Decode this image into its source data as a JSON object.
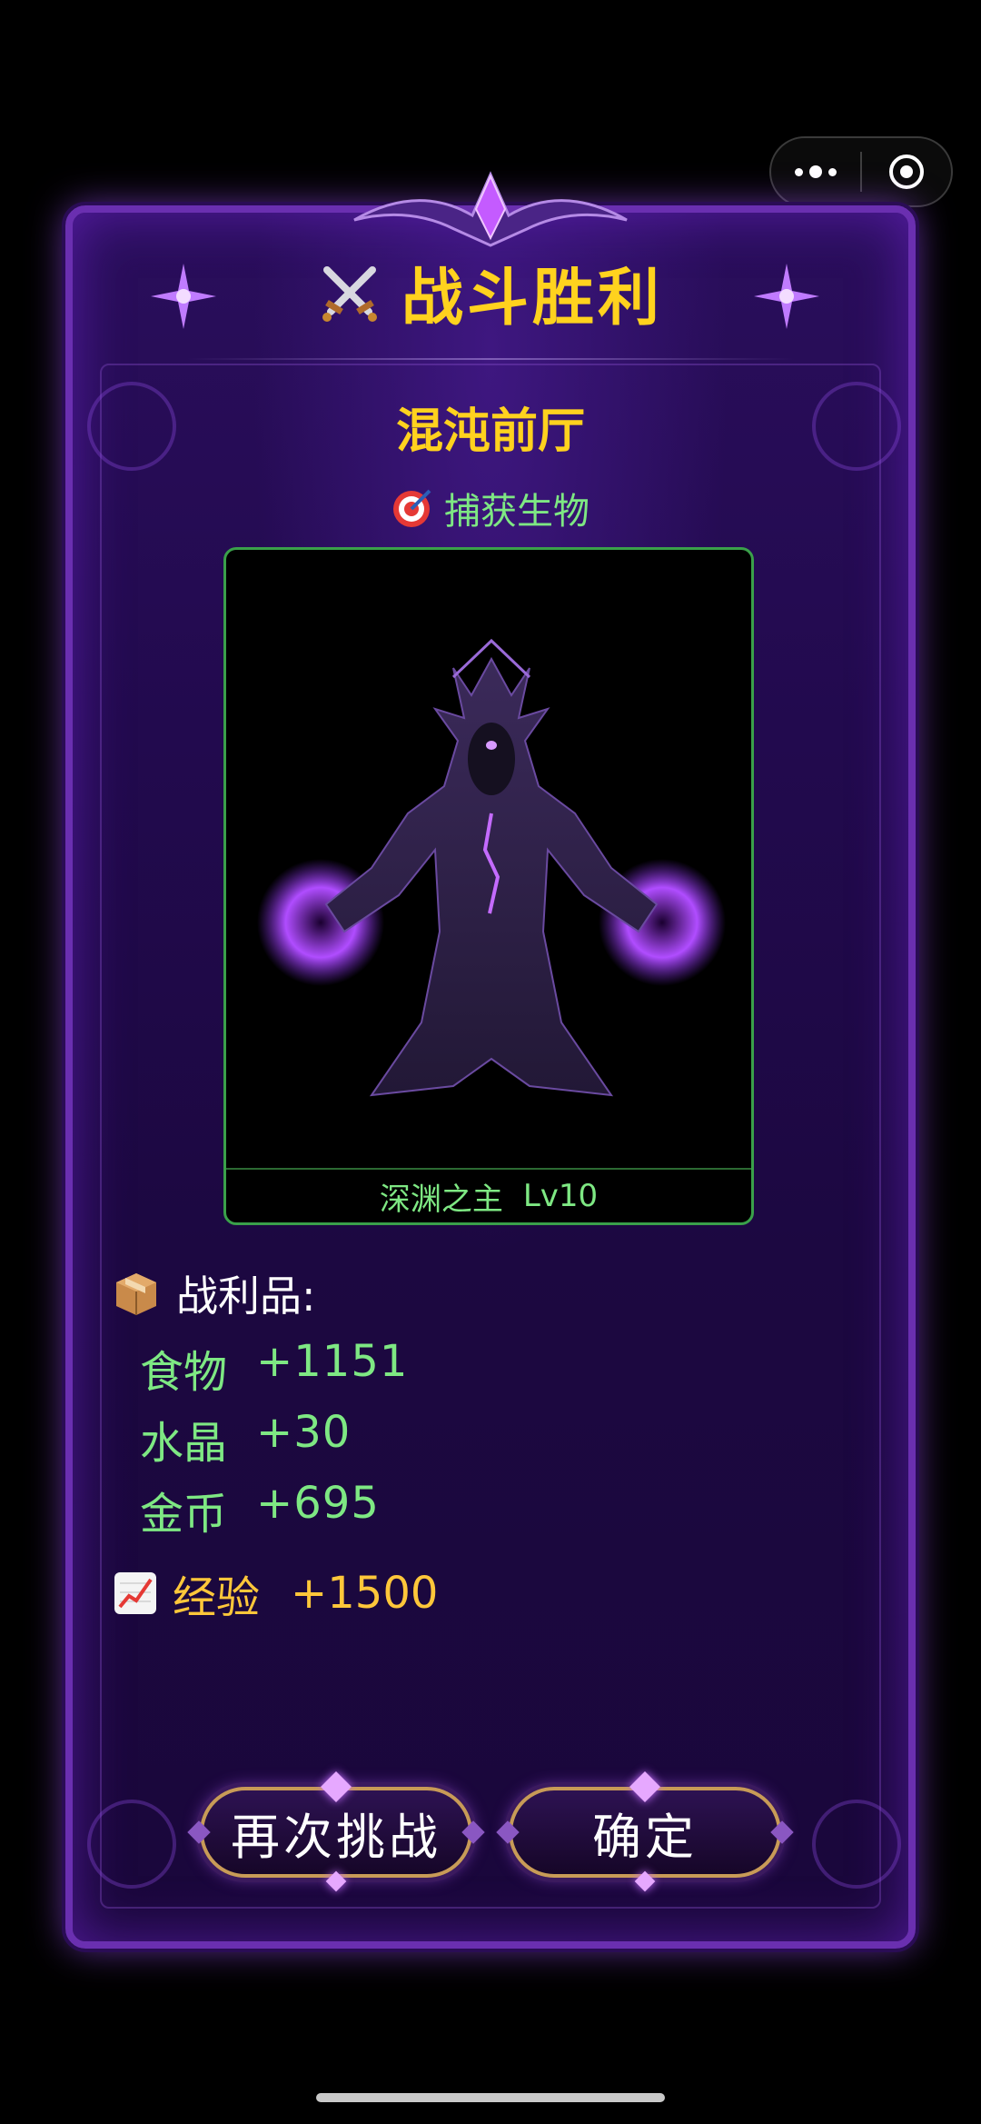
{
  "capsule": {
    "menu_icon": "more-dots-icon",
    "close_icon": "target-circle-icon"
  },
  "header": {
    "title": "战斗胜利",
    "icon": "crossed-swords-icon"
  },
  "location": {
    "name": "混沌前厅"
  },
  "capture": {
    "icon": "dart-target-icon",
    "label": "捕获生物"
  },
  "creature": {
    "name": "深渊之主",
    "level": "Lv10"
  },
  "loot": {
    "icon": "package-icon",
    "title": "战利品:",
    "items": [
      {
        "name": "食物",
        "value": "+1151"
      },
      {
        "name": "水晶",
        "value": "+30"
      },
      {
        "name": "金币",
        "value": "+695"
      }
    ]
  },
  "experience": {
    "icon": "chart-increasing-icon",
    "label": "经验",
    "value": "+1500"
  },
  "buttons": {
    "retry": "再次挑战",
    "confirm": "确定"
  },
  "colors": {
    "title_gold": "#ffd21e",
    "loot_green": "#7ee883",
    "exp_orange": "#ffc73a",
    "frame_purple": "#6a2fb0"
  }
}
